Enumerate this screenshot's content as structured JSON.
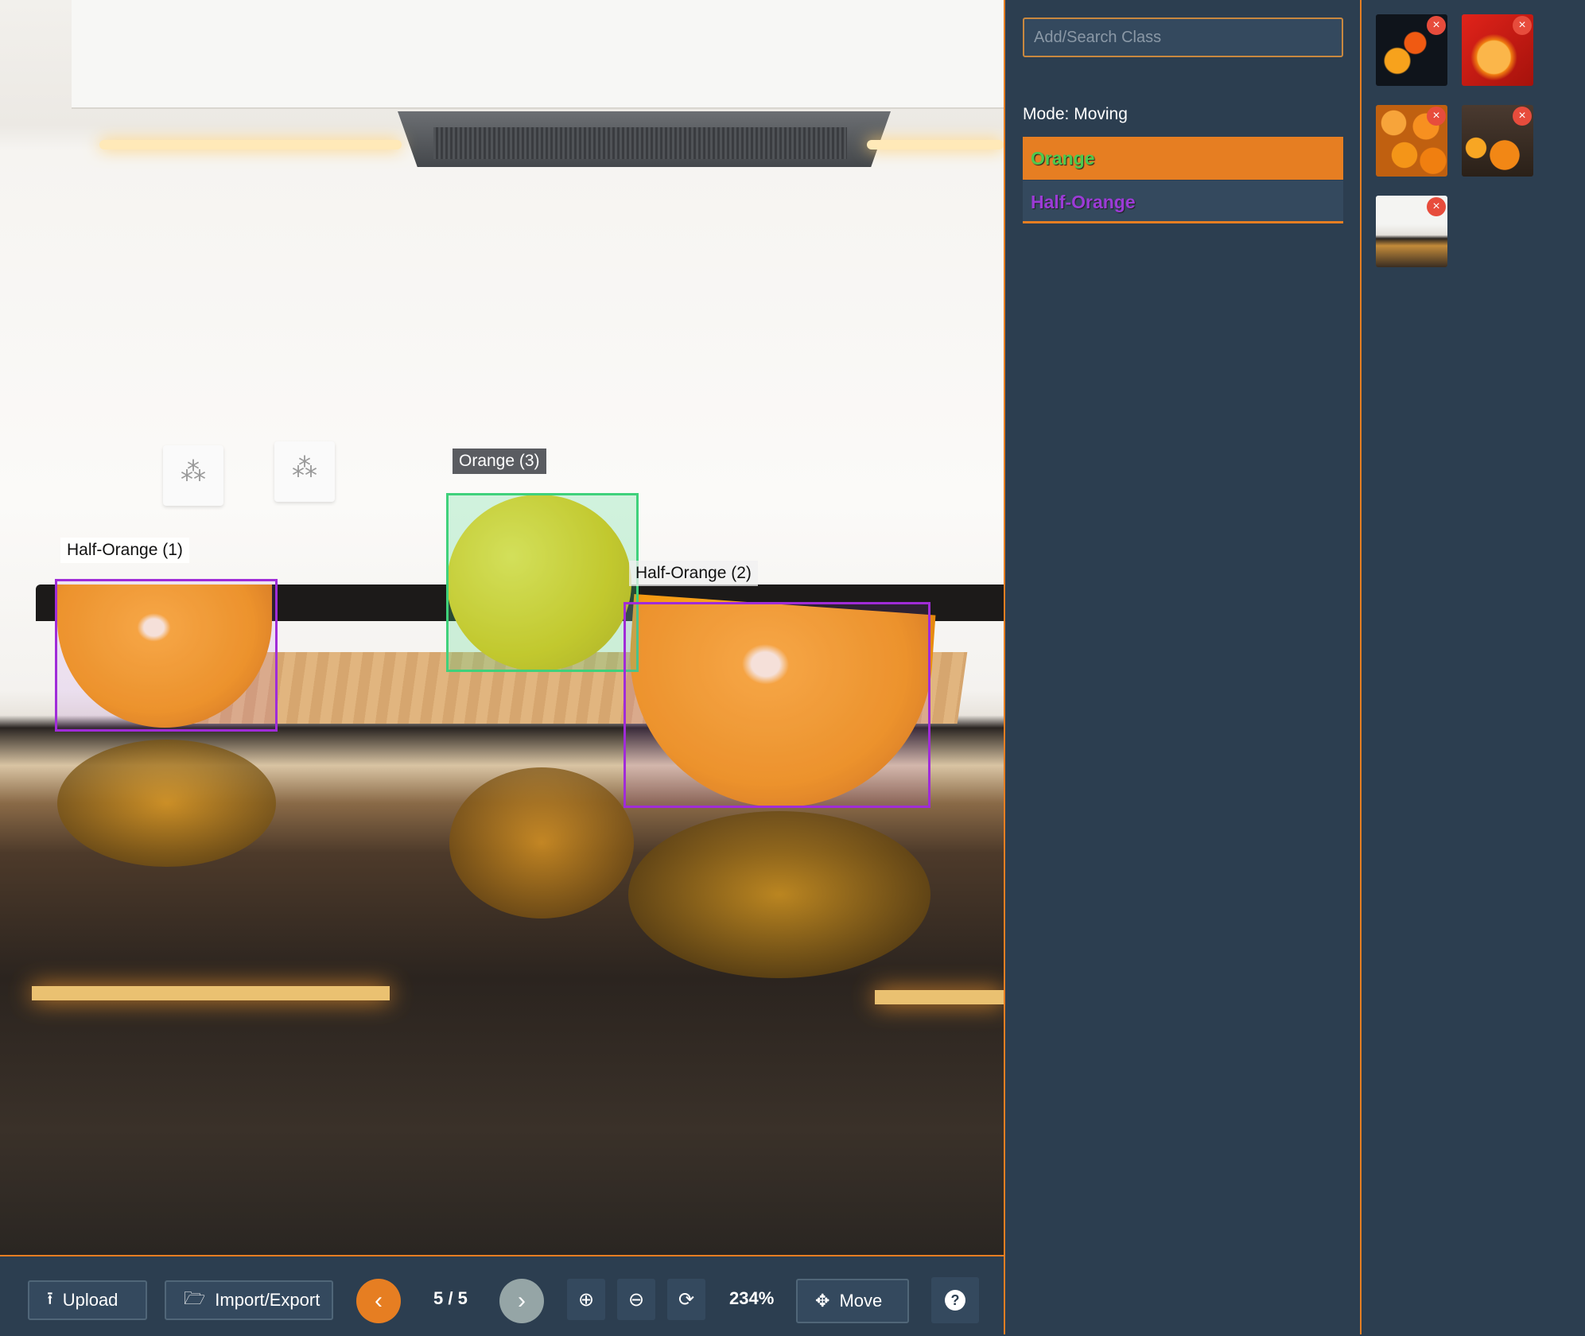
{
  "colors": {
    "accent": "#e67e22",
    "panel": "#2c3e50",
    "half_orange_box": "#a02cd8",
    "orange_box": "#3fd17b"
  },
  "canvas": {
    "annotations": [
      {
        "label": "Half-Orange (1)",
        "class": "Half-Orange"
      },
      {
        "label": "Orange (3)",
        "class": "Orange"
      },
      {
        "label": "Half-Orange (2)",
        "class": "Half-Orange"
      }
    ]
  },
  "toolbar": {
    "upload_label": "Upload",
    "upload_icon": "upload-icon",
    "import_export_label": "Import/Export",
    "import_export_icon": "folder-open-icon",
    "prev_icon": "chevron-left-icon",
    "page_indicator": "5 / 5",
    "next_icon": "chevron-right-icon",
    "zoom_in_icon": "zoom-in-icon",
    "zoom_out_icon": "zoom-out-icon",
    "reset_icon": "refresh-icon",
    "zoom_level": "234%",
    "move_label": "Move",
    "move_icon": "move-arrows-icon",
    "help_icon": "question-circle-icon"
  },
  "class_panel": {
    "search_placeholder": "Add/Search Class",
    "mode_label": "Mode: Moving",
    "classes": [
      {
        "name": "Orange",
        "selected": true,
        "color": "#4ec94e"
      },
      {
        "name": "Half-Orange",
        "selected": false,
        "color": "#9b3bd6"
      }
    ]
  },
  "thumbnails": {
    "delete_glyph": "×",
    "items": [
      {
        "name": "thumbnail-1"
      },
      {
        "name": "thumbnail-2"
      },
      {
        "name": "thumbnail-3"
      },
      {
        "name": "thumbnail-4"
      },
      {
        "name": "thumbnail-5"
      }
    ]
  }
}
